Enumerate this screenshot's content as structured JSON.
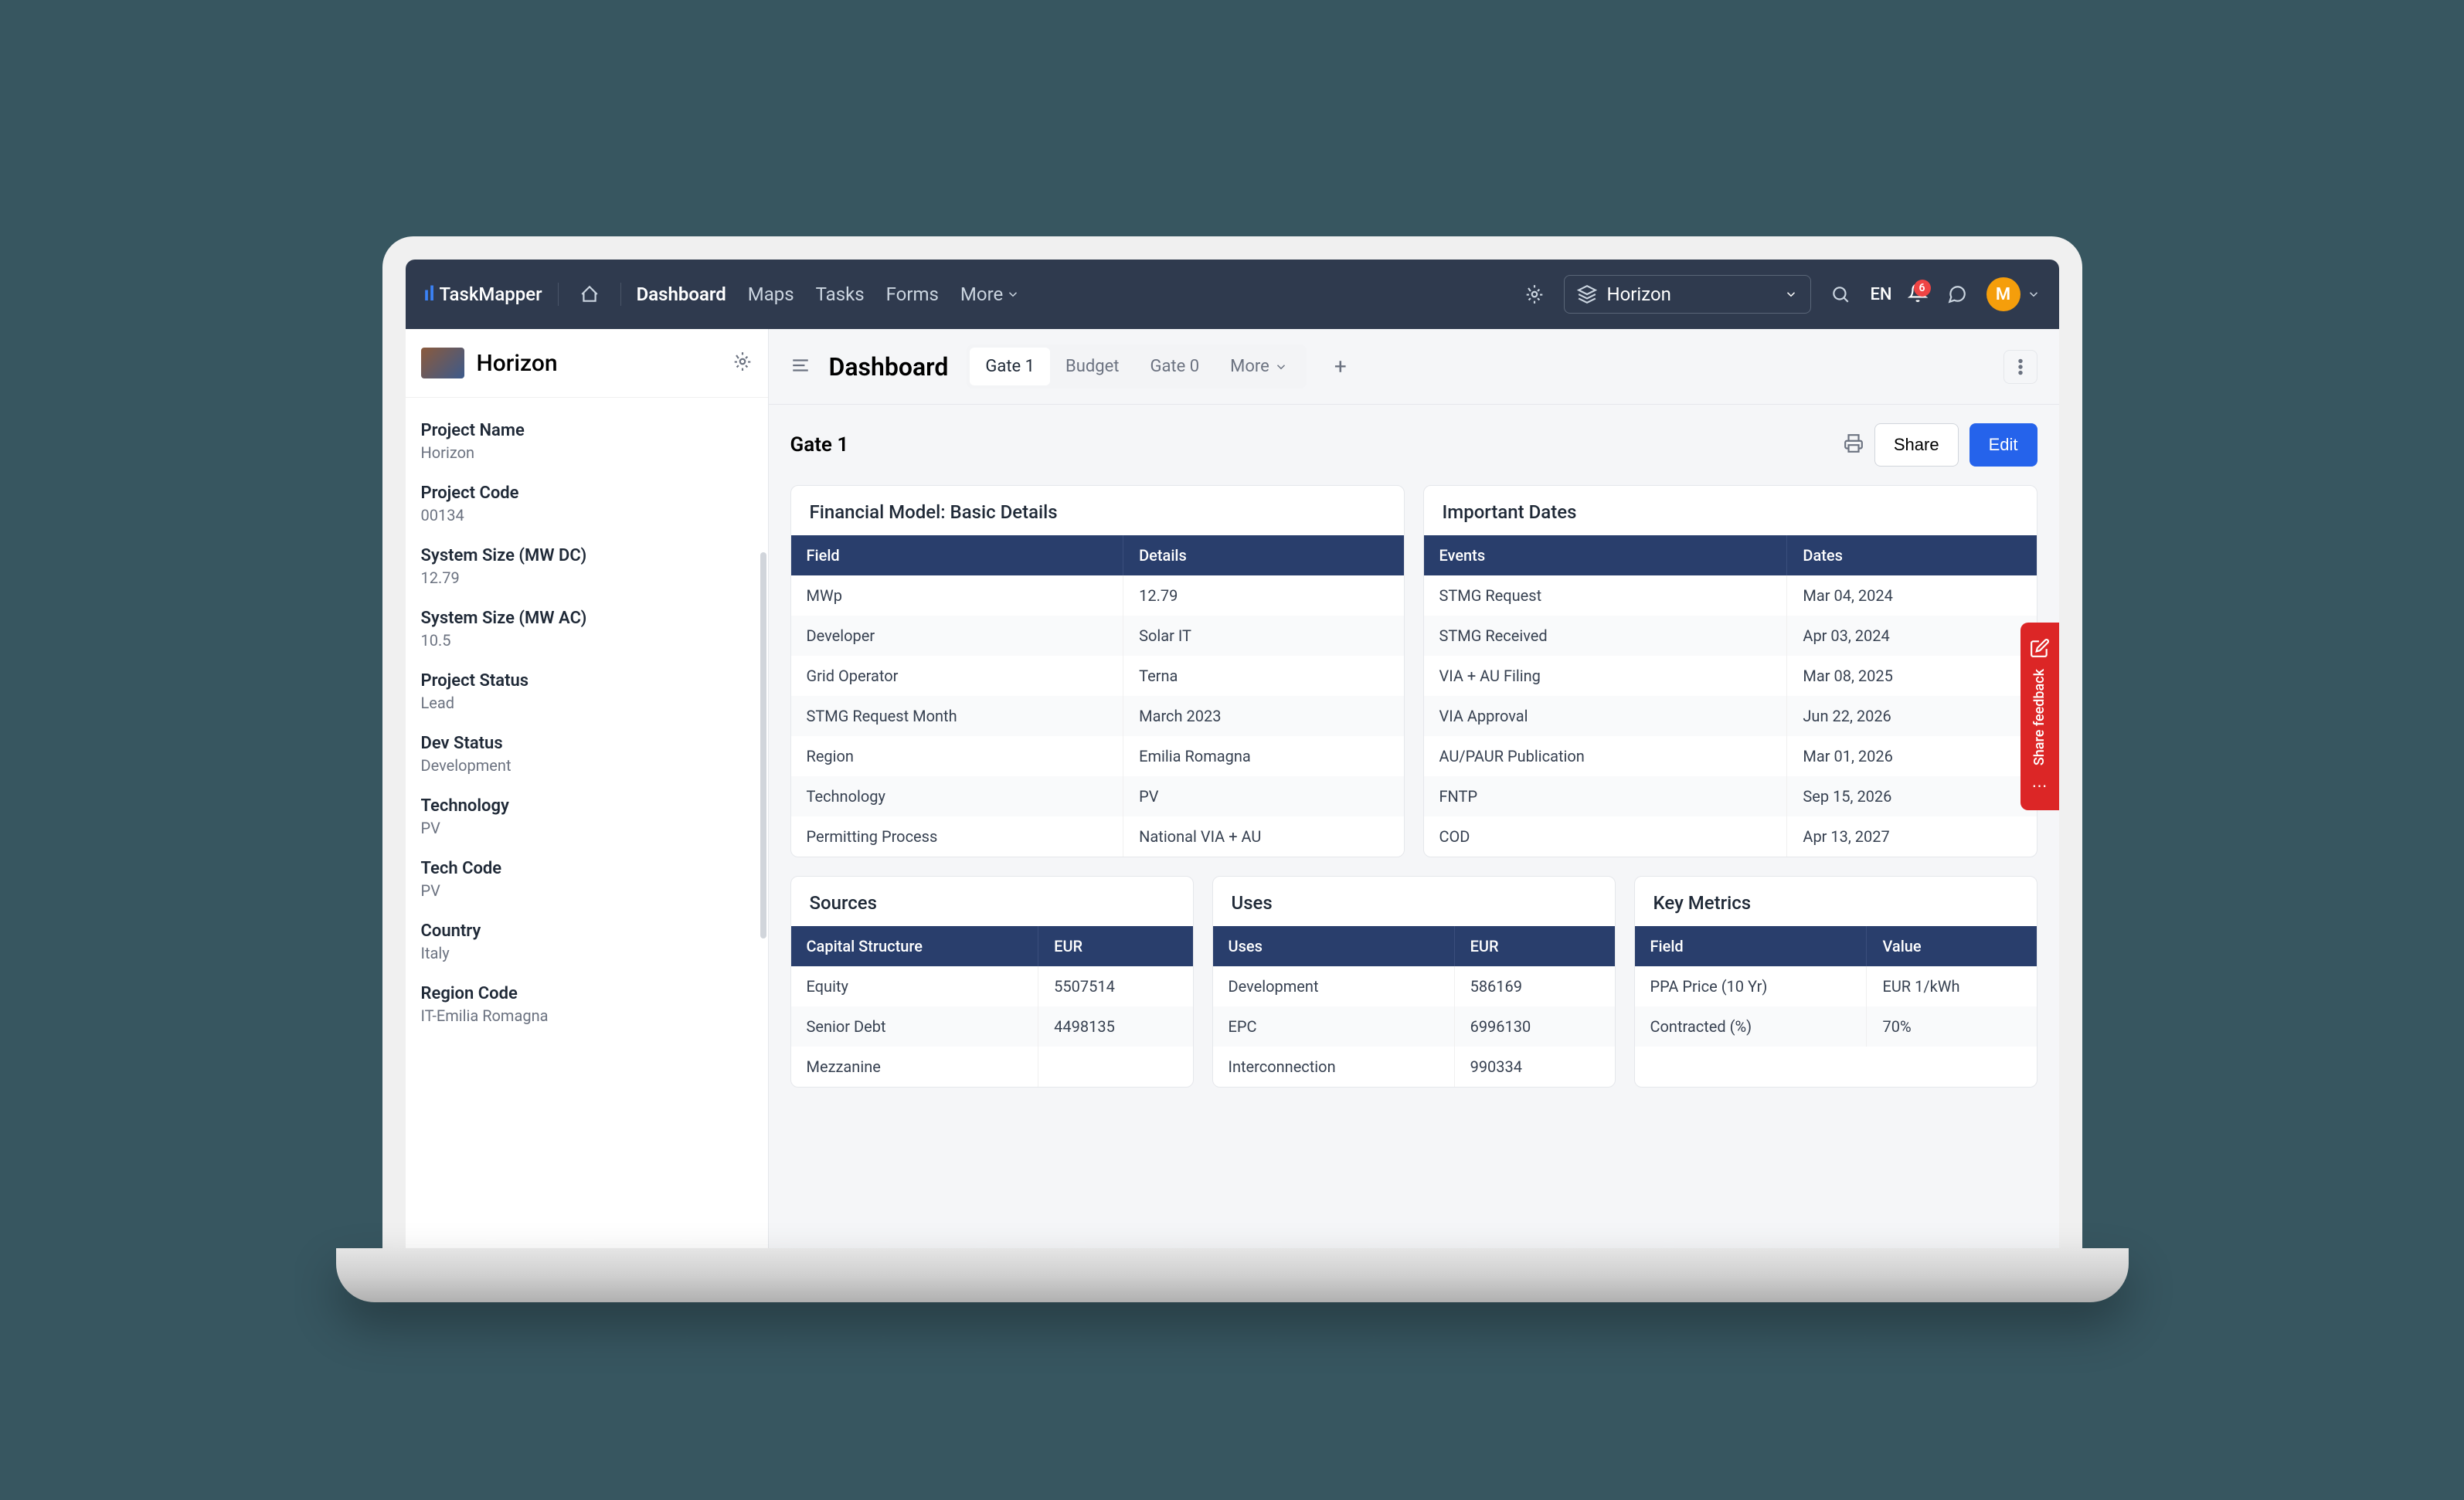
{
  "brand": "TaskMapper",
  "nav": {
    "links": [
      "Dashboard",
      "Maps",
      "Tasks",
      "Forms"
    ],
    "more": "More",
    "active": "Dashboard"
  },
  "project_selector": "Horizon",
  "lang": "EN",
  "notification_count": "6",
  "avatar_initial": "M",
  "sidebar": {
    "project_name": "Horizon",
    "fields": [
      {
        "label": "Project Name",
        "value": "Horizon"
      },
      {
        "label": "Project Code",
        "value": "00134"
      },
      {
        "label": "System Size (MW DC)",
        "value": "12.79"
      },
      {
        "label": "System Size (MW AC)",
        "value": "10.5"
      },
      {
        "label": "Project Status",
        "value": "Lead"
      },
      {
        "label": "Dev Status",
        "value": "Development"
      },
      {
        "label": "Technology",
        "value": "PV"
      },
      {
        "label": "Tech Code",
        "value": "PV"
      },
      {
        "label": "Country",
        "value": "Italy"
      },
      {
        "label": "Region Code",
        "value": "IT-Emilia Romagna"
      }
    ]
  },
  "main": {
    "title": "Dashboard",
    "tabs": [
      "Gate 1",
      "Budget",
      "Gate 0"
    ],
    "tabs_more": "More",
    "active_tab": "Gate 1",
    "subtitle": "Gate 1",
    "share_btn": "Share",
    "edit_btn": "Edit"
  },
  "cards": {
    "financial": {
      "title": "Financial Model: Basic Details",
      "headers": [
        "Field",
        "Details"
      ],
      "rows": [
        [
          "MWp",
          "12.79"
        ],
        [
          "Developer",
          "Solar IT"
        ],
        [
          "Grid Operator",
          "Terna"
        ],
        [
          "STMG Request Month",
          "March 2023"
        ],
        [
          "Region",
          "Emilia Romagna"
        ],
        [
          "Technology",
          "PV"
        ],
        [
          "Permitting Process",
          "National VIA + AU"
        ]
      ]
    },
    "dates": {
      "title": "Important Dates",
      "headers": [
        "Events",
        "Dates"
      ],
      "rows": [
        [
          "STMG Request",
          "Mar 04, 2024"
        ],
        [
          "STMG Received",
          "Apr 03, 2024"
        ],
        [
          "VIA + AU Filing",
          "Mar 08, 2025"
        ],
        [
          "VIA Approval",
          "Jun 22, 2026"
        ],
        [
          "AU/PAUR Publication",
          "Mar 01, 2026"
        ],
        [
          "FNTP",
          "Sep 15, 2026"
        ],
        [
          "COD",
          "Apr 13, 2027"
        ]
      ]
    },
    "sources": {
      "title": "Sources",
      "headers": [
        "Capital Structure",
        "EUR"
      ],
      "rows": [
        [
          "Equity",
          "5507514"
        ],
        [
          "Senior Debt",
          "4498135"
        ],
        [
          "Mezzanine",
          ""
        ]
      ]
    },
    "uses": {
      "title": "Uses",
      "headers": [
        "Uses",
        "EUR"
      ],
      "rows": [
        [
          "Development",
          "586169"
        ],
        [
          "EPC",
          "6996130"
        ],
        [
          "Interconnection",
          "990334"
        ]
      ]
    },
    "metrics": {
      "title": "Key Metrics",
      "headers": [
        "Field",
        "Value"
      ],
      "rows": [
        [
          "PPA Price (10 Yr)",
          "EUR 1/kWh"
        ],
        [
          "Contracted (%)",
          "70%"
        ]
      ]
    }
  },
  "feedback": "Share feedback"
}
